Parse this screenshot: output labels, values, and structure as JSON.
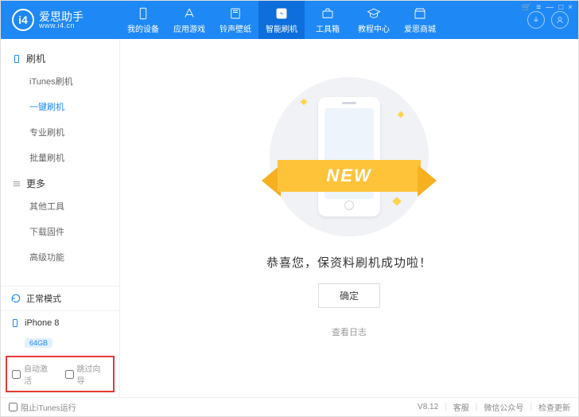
{
  "app": {
    "name": "爱思助手",
    "url": "www.i4.cn",
    "logo_letter": "i4"
  },
  "window_controls": {
    "cart": "🛒",
    "menu": "≡",
    "min": "—",
    "max": "□",
    "close": "×"
  },
  "tabs": [
    {
      "id": "device",
      "label": "我的设备"
    },
    {
      "id": "apps",
      "label": "应用游戏"
    },
    {
      "id": "ring",
      "label": "铃声壁纸"
    },
    {
      "id": "flash",
      "label": "智能刷机",
      "active": true
    },
    {
      "id": "tools",
      "label": "工具箱"
    },
    {
      "id": "tutorial",
      "label": "教程中心"
    },
    {
      "id": "mall",
      "label": "爱思商城"
    }
  ],
  "sidebar": {
    "group1_title": "刷机",
    "group1_items": [
      {
        "label": "iTunes刷机"
      },
      {
        "label": "一键刷机",
        "active": true
      },
      {
        "label": "专业刷机"
      },
      {
        "label": "批量刷机"
      }
    ],
    "group2_title": "更多",
    "group2_items": [
      {
        "label": "其他工具"
      },
      {
        "label": "下载固件"
      },
      {
        "label": "高级功能"
      }
    ],
    "mode": "正常模式",
    "device_name": "iPhone 8",
    "storage_badge": "64GB",
    "checkbox_auto_activate": "自动激活",
    "checkbox_skip_wizard": "跳过向导"
  },
  "main": {
    "ribbon_text": "NEW",
    "success_text": "恭喜您，保资料刷机成功啦！",
    "ok_button": "确定",
    "log_link": "查看日志"
  },
  "footer": {
    "block_itunes": "阻止iTunes运行",
    "version": "V8.12",
    "support": "客服",
    "wechat": "微信公众号",
    "update": "检查更新"
  }
}
